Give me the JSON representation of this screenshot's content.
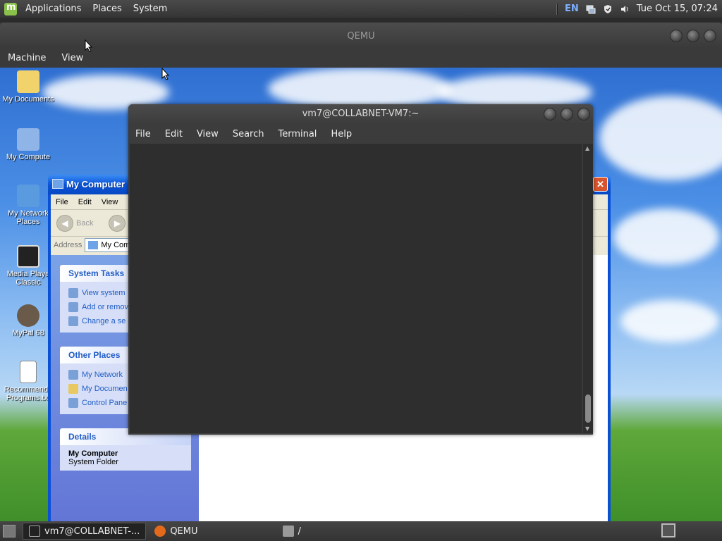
{
  "top_panel": {
    "menu": [
      "Applications",
      "Places",
      "System"
    ],
    "lang": "EN",
    "clock": "Tue Oct 15, 07:24"
  },
  "qemu": {
    "title": "QEMU",
    "menu": [
      "Machine",
      "View"
    ]
  },
  "desktop_icons": [
    {
      "label": "My Documents",
      "icon": "folder-documents-icon"
    },
    {
      "label": "My Compute",
      "icon": "computer-icon"
    },
    {
      "label": "My Network Places",
      "icon": "network-icon"
    },
    {
      "label": "Media Playe Classic",
      "icon": "media-player-icon"
    },
    {
      "label": "MyPal 68",
      "icon": "mypal-icon"
    },
    {
      "label": "Recommende Programs.txt",
      "icon": "text-file-icon"
    }
  ],
  "xp_window": {
    "title": "My Computer",
    "menu": [
      "File",
      "Edit",
      "View"
    ],
    "back_label": "Back",
    "address_label": "Address",
    "address_value": "My Com",
    "system_tasks": {
      "title": "System Tasks",
      "items": [
        "View system",
        "Add or remov",
        "Change a se"
      ]
    },
    "other_places": {
      "title": "Other Places",
      "items": [
        "My Network",
        "My Documen",
        "Control Pane"
      ]
    },
    "details": {
      "title": "Details",
      "name": "My Computer",
      "type": "System Folder"
    }
  },
  "terminal": {
    "title": "vm7@COLLABNET-VM7:~",
    "menu": [
      "File",
      "Edit",
      "View",
      "Search",
      "Terminal",
      "Help"
    ]
  },
  "taskbar": {
    "items": [
      {
        "label": "vm7@COLLABNET-...",
        "icon": "terminal-icon",
        "active": true
      },
      {
        "label": "QEMU",
        "icon": "qemu-icon",
        "active": false
      },
      {
        "label": "/",
        "icon": "folder-icon",
        "active": false
      }
    ]
  }
}
